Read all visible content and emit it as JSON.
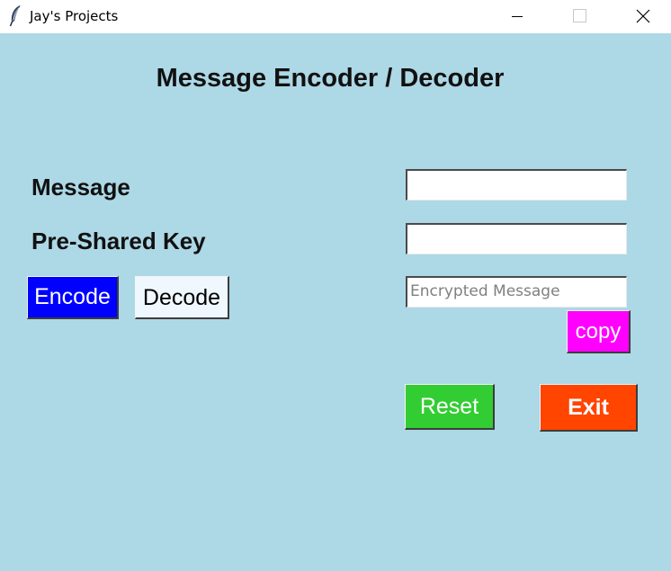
{
  "window": {
    "title": "Jay's Projects",
    "icon": "feather-icon",
    "controls": [
      "minimize-icon",
      "maximize-icon",
      "close-icon"
    ]
  },
  "app": {
    "heading": "Message Encoder / Decoder",
    "background_color": "#add8e6"
  },
  "form": {
    "message_label": "Message",
    "message_value": "",
    "key_label": "Pre-Shared Key",
    "key_value": "",
    "encrypted_value": "Encrypted Message"
  },
  "buttons": {
    "encode": {
      "label": "Encode",
      "color": "#0000ff"
    },
    "decode": {
      "label": "Decode",
      "color": "#f0f8ff"
    },
    "copy": {
      "label": "copy",
      "color": "#ff00ff"
    },
    "reset": {
      "label": "Reset",
      "color": "#32cd32"
    },
    "exit": {
      "label": "Exit",
      "color": "#ff4500"
    }
  }
}
